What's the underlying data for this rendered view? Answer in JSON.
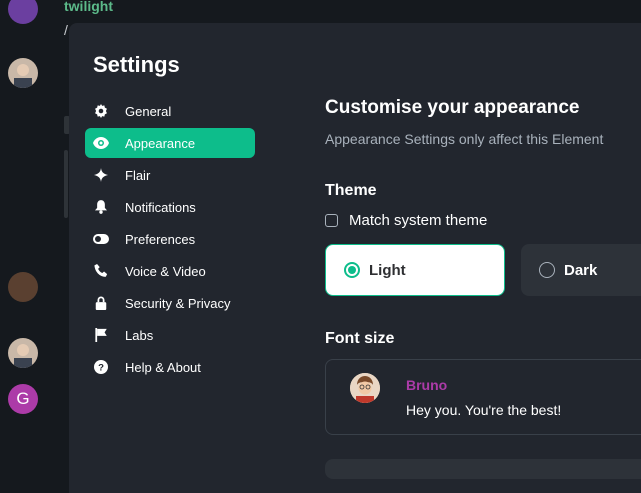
{
  "background": {
    "room_name": "twilight",
    "slash_text": "/",
    "avatar_letter": "G"
  },
  "dialog": {
    "title": "Settings",
    "nav": [
      {
        "label": "General",
        "icon": "gear-icon",
        "active": false
      },
      {
        "label": "Appearance",
        "icon": "eye-icon",
        "active": true
      },
      {
        "label": "Flair",
        "icon": "sparkle-icon",
        "active": false
      },
      {
        "label": "Notifications",
        "icon": "bell-icon",
        "active": false
      },
      {
        "label": "Preferences",
        "icon": "toggle-icon",
        "active": false
      },
      {
        "label": "Voice & Video",
        "icon": "phone-icon",
        "active": false
      },
      {
        "label": "Security & Privacy",
        "icon": "lock-icon",
        "active": false
      },
      {
        "label": "Labs",
        "icon": "flag-icon",
        "active": false
      },
      {
        "label": "Help & About",
        "icon": "help-icon",
        "active": false
      }
    ]
  },
  "appearance": {
    "heading": "Customise your appearance",
    "subtext": "Appearance Settings only affect this Element",
    "theme": {
      "title": "Theme",
      "match_system_label": "Match system theme",
      "match_system_checked": false,
      "options": [
        {
          "label": "Light",
          "selected": true
        },
        {
          "label": "Dark",
          "selected": false
        }
      ]
    },
    "font_size": {
      "title": "Font size",
      "preview_name": "Bruno",
      "preview_message": "Hey you. You're the best!"
    }
  },
  "colors": {
    "accent": "#0dbd8b",
    "dialog_bg": "#22262e",
    "preview_name": "#ac3ba8"
  }
}
